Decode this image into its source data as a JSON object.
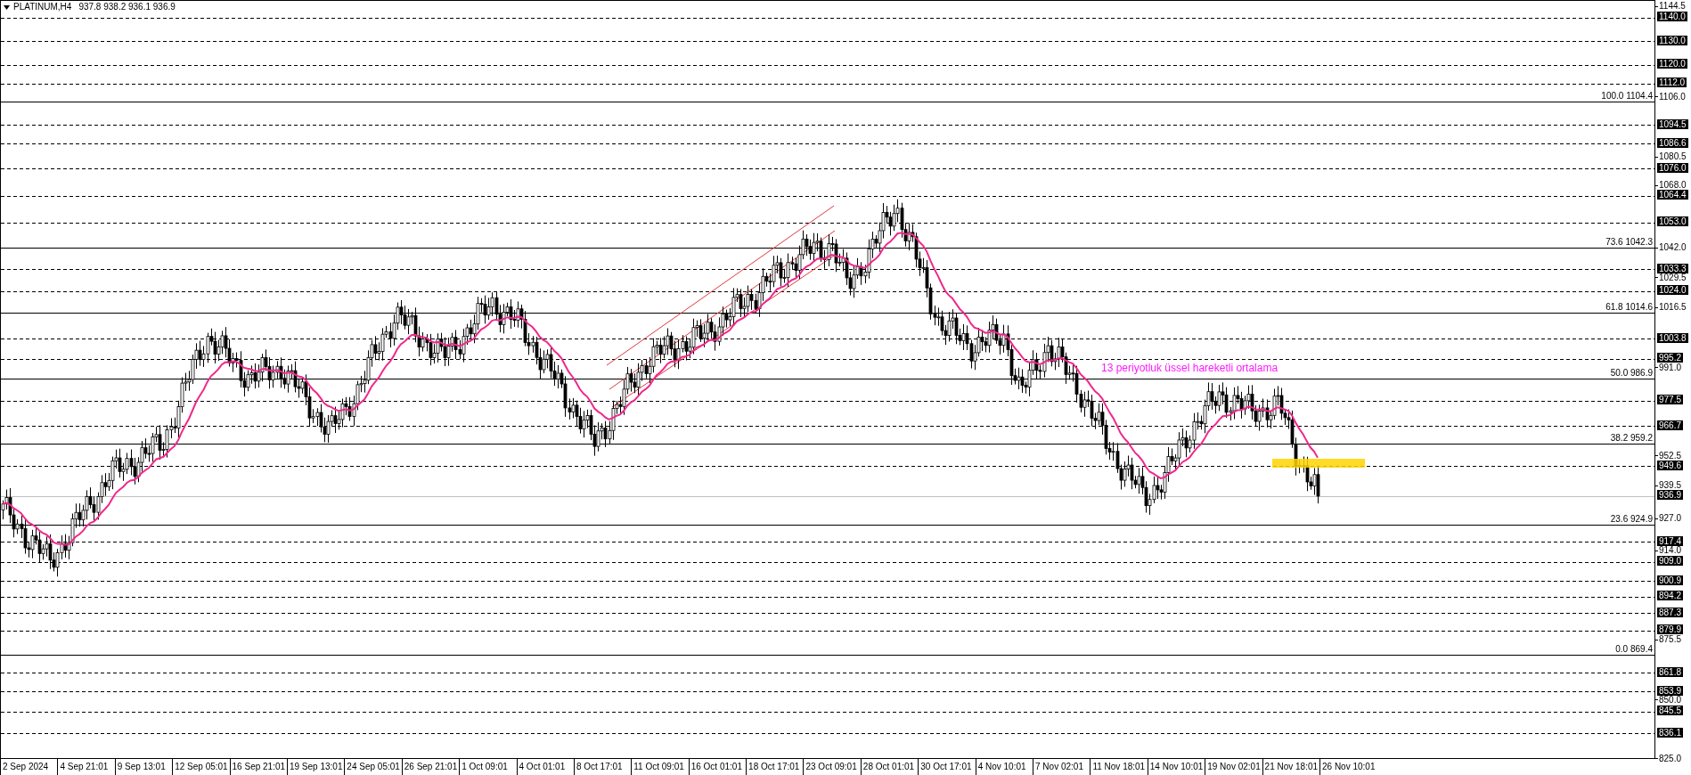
{
  "header": {
    "symbol": "PLATINUM,H4",
    "ohlc": "937.8 938.2 936.1 936.9"
  },
  "annotation": "13 periyotluk üssel hareketli ortalama",
  "horizontal_lines": [
    {
      "kind": "dashed",
      "label": "1140.0"
    },
    {
      "kind": "dashed",
      "label": "1130.0"
    },
    {
      "kind": "dashed",
      "label": "1120.0"
    },
    {
      "kind": "dashed",
      "label": "1112.0"
    },
    {
      "kind": "dashed",
      "label": "1094.5"
    },
    {
      "kind": "dashed",
      "label": "1086.6"
    },
    {
      "kind": "dashed",
      "label": "1076.0"
    },
    {
      "kind": "dashed",
      "label": "1064.4"
    },
    {
      "kind": "dashed",
      "label": "1053.0"
    },
    {
      "kind": "dashed",
      "label": "1033.3"
    },
    {
      "kind": "dashed",
      "label": "1024.0"
    },
    {
      "kind": "dashed",
      "label": "1003.8"
    },
    {
      "kind": "dashed",
      "label": "995.2"
    },
    {
      "kind": "dashed",
      "label": "977.5"
    },
    {
      "kind": "dashed",
      "label": "966.7"
    },
    {
      "kind": "dashed",
      "label": "949.6"
    },
    {
      "kind": "bid",
      "label": "936.9"
    },
    {
      "kind": "dashed",
      "label": "917.4"
    },
    {
      "kind": "dashed",
      "label": "909.0"
    },
    {
      "kind": "dashed",
      "label": "900.9"
    },
    {
      "kind": "dashed",
      "label": "894.2"
    },
    {
      "kind": "dashed",
      "label": "887.3"
    },
    {
      "kind": "dashed",
      "label": "879.9"
    },
    {
      "kind": "dashed",
      "label": "861.8"
    },
    {
      "kind": "dashed",
      "label": "853.9"
    },
    {
      "kind": "dashed",
      "label": "845.5"
    },
    {
      "kind": "dashed",
      "label": "836.1"
    }
  ],
  "fibonacci_levels": [
    {
      "label": "100.0 1104.4"
    },
    {
      "label": "73.6 1042.3"
    },
    {
      "label": "61.8 1014.6"
    },
    {
      "label": "50.0 986.9"
    },
    {
      "label": "38.2 959.2"
    },
    {
      "label": "23.6 924.9"
    },
    {
      "label": "0.0 869.4"
    }
  ],
  "price_axis": {
    "ticks": [
      "1144.5",
      "1106.0",
      "1080.5",
      "1068.0",
      "1042.0",
      "1029.5",
      "1016.5",
      "991.0",
      "952.5",
      "939.5",
      "927.0",
      "914.0",
      "875.5",
      "850.0",
      "825.0"
    ]
  },
  "time_axis": {
    "labels": [
      "2 Sep 2024",
      "4 Sep 21:01",
      "9 Sep 13:01",
      "12 Sep 05:01",
      "16 Sep 21:01",
      "19 Sep 13:01",
      "24 Sep 05:01",
      "26 Sep 21:01",
      "1 Oct 09:01",
      "4 Oct 01:01",
      "8 Oct 17:01",
      "11 Oct 09:01",
      "16 Oct 01:01",
      "18 Oct 17:01",
      "23 Oct 09:01",
      "28 Oct 01:01",
      "30 Oct 17:01",
      "4 Nov 10:01",
      "7 Nov 02:01",
      "11 Nov 18:01",
      "14 Nov 10:01",
      "19 Nov 02:01",
      "21 Nov 18:01",
      "26 Nov 10:01"
    ]
  }
}
